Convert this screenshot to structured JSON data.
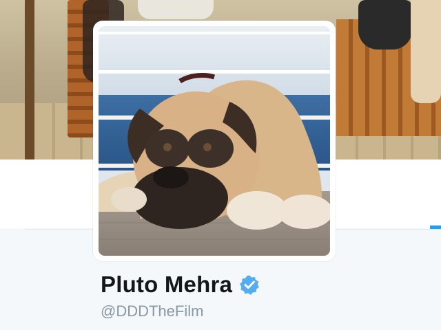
{
  "profile": {
    "name": "Pluto Mehra",
    "handle": "@DDDTheFilm",
    "verified": true
  },
  "colors": {
    "accent": "#1da1f2",
    "verified_badge": "#55acee",
    "name_text": "#14171a",
    "handle_text": "#8899a6"
  },
  "icons": {
    "verified": "verified-badge-icon"
  }
}
